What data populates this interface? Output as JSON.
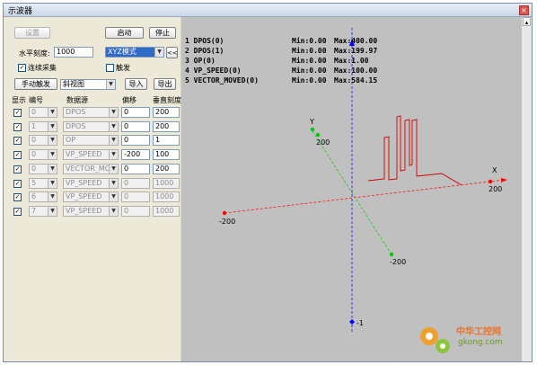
{
  "window": {
    "title": "示波器"
  },
  "toolbar": {
    "settings_label": "设置",
    "start_label": "启动",
    "stop_label": "停止",
    "scale_label": "水平刻度:",
    "scale_value": "1000",
    "mode_value": "XYZ模式",
    "collapse_label": "<<",
    "continuous_label": "连续采集",
    "trigger_label": "触发",
    "manual_trigger_label": "手动触发",
    "view_value": "斜视图",
    "import_label": "导入",
    "export_label": "导出"
  },
  "table": {
    "headers": [
      "显示",
      "编号",
      "数据源",
      "偏移",
      "垂直刻度"
    ],
    "rows": [
      {
        "show": true,
        "num": "0",
        "source": "DPOS",
        "offset": "0",
        "scale": "200",
        "enabled": true
      },
      {
        "show": true,
        "num": "1",
        "source": "DPOS",
        "offset": "0",
        "scale": "200",
        "enabled": true
      },
      {
        "show": true,
        "num": "0",
        "source": "OP",
        "offset": "0",
        "scale": "1",
        "enabled": true
      },
      {
        "show": true,
        "num": "0",
        "source": "VP_SPEED",
        "offset": "-200",
        "scale": "100",
        "enabled": true
      },
      {
        "show": true,
        "num": "0",
        "source": "VECTOR_MOVED",
        "offset": "0",
        "scale": "200",
        "enabled": true
      },
      {
        "show": true,
        "num": "5",
        "source": "VP_SPEED",
        "offset": "0",
        "scale": "1000",
        "enabled": false
      },
      {
        "show": true,
        "num": "6",
        "source": "VP_SPEED",
        "offset": "0",
        "scale": "1000",
        "enabled": false
      },
      {
        "show": true,
        "num": "7",
        "source": "VP_SPEED",
        "offset": "0",
        "scale": "1000",
        "enabled": false
      }
    ]
  },
  "legend": [
    {
      "name": "1 DPOS(0)",
      "min": "Min:0.00",
      "max": "Max:400.00"
    },
    {
      "name": "2 DPOS(1)",
      "min": "Min:0.00",
      "max": "Max:199.97"
    },
    {
      "name": "3 OP(0)",
      "min": "Min:0.00",
      "max": "Max:1.00"
    },
    {
      "name": "4 VP_SPEED(0)",
      "min": "Min:0.00",
      "max": "Max:100.00"
    },
    {
      "name": "5 VECTOR_MOVED(0)",
      "min": "Min:0.00",
      "max": "Max:584.15"
    }
  ],
  "axes": {
    "x_name": "X",
    "y_name": "Y",
    "x_pos_label": "200",
    "x_neg_label": "-200",
    "y_pos_label": "200",
    "y_neg_label": "-200",
    "z_neg_label": "-1"
  },
  "watermark": {
    "cn": "中华工控网",
    "url": "gkong.com"
  },
  "colors": {
    "x_axis": "#ff0000",
    "y_axis": "#00c800",
    "z_axis": "#0000ff",
    "trace": "#cc0000"
  }
}
